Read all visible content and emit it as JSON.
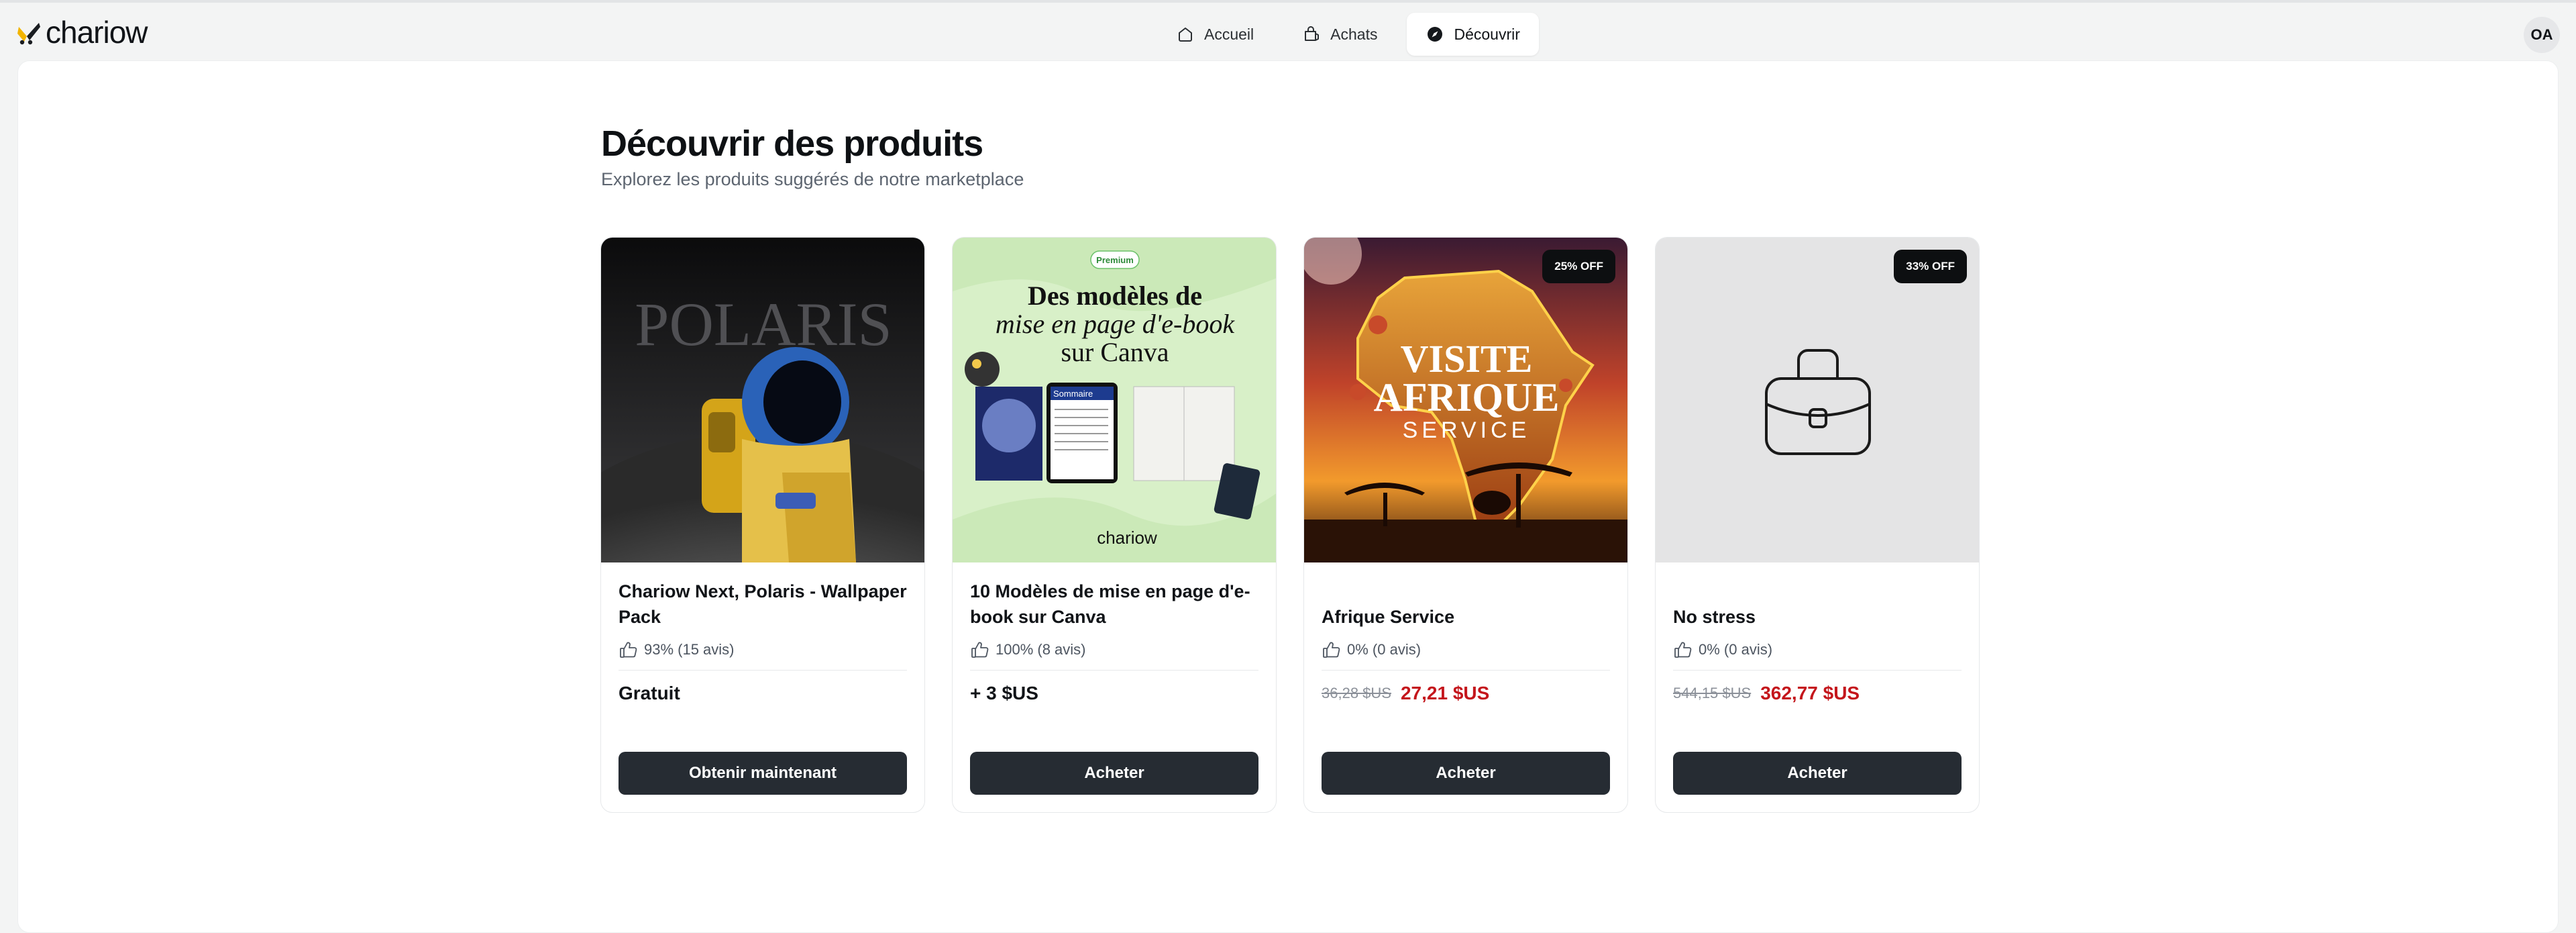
{
  "app": {
    "logo_text": "chariow"
  },
  "nav": {
    "items": [
      {
        "label": "Accueil",
        "icon": "home-icon",
        "active": false
      },
      {
        "label": "Achats",
        "icon": "bag-icon",
        "active": false
      },
      {
        "label": "Découvrir",
        "icon": "compass-icon",
        "active": true
      }
    ]
  },
  "user": {
    "initials": "OA"
  },
  "page": {
    "title": "Découvrir des produits",
    "subtitle": "Explorez les produits suggérés de notre marketplace"
  },
  "colors": {
    "cta": "#262c33",
    "discount_price": "#c4161c",
    "accent": "#f2b400"
  },
  "products": [
    {
      "title": "Chariow Next, Polaris - Wallpaper Pack",
      "rating": "93% (15 avis)",
      "price": "Gratuit",
      "cta": "Obtenir maintenant",
      "image_text": "POLARIS"
    },
    {
      "title": "10 Modèles de mise en page d'e-book sur Canva",
      "rating": "100% (8 avis)",
      "price": "+ 3 $US",
      "cta": "Acheter",
      "image_badge": "Premium",
      "image_line1": "Des modèles de",
      "image_line2": "mise en page d'e-book",
      "image_line3": "sur Canva",
      "image_book_label": "Sommaire",
      "image_logo": "chariow"
    },
    {
      "title": "Afrique Service",
      "rating": "0% (0 avis)",
      "old_price": "36,28 $US",
      "new_price": "27,21 $US",
      "cta": "Acheter",
      "badge": "25% OFF",
      "image_line1": "VISITE",
      "image_line2": "AFRIQUE",
      "image_line3": "SERVICE"
    },
    {
      "title": "No stress",
      "rating": "0% (0 avis)",
      "old_price": "544,15 $US",
      "new_price": "362,77 $US",
      "cta": "Acheter",
      "badge": "33% OFF"
    }
  ]
}
